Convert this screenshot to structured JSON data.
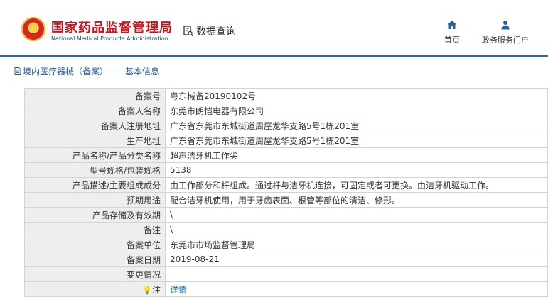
{
  "header": {
    "logo_cn": "国家药品监督管理局",
    "logo_en": "National Medical Products Administration",
    "query_label": "数据查询",
    "nav": [
      {
        "label": "首页",
        "icon": "home-icon"
      },
      {
        "label": "政务服务门户",
        "icon": "user-icon"
      }
    ]
  },
  "panel": {
    "title": "境内医疗器械（备案）——基本信息"
  },
  "rows": [
    {
      "label": "备案号",
      "value": "粤东械备20190102号"
    },
    {
      "label": "备案人名称",
      "value": "东莞市朗恺电器有限公司"
    },
    {
      "label": "备案人注册地址",
      "value": "广东省东莞市东城街道周屋龙华支路5号1栋201室"
    },
    {
      "label": "生产地址",
      "value": "广东省东莞市东城街道周屋龙华支路5号1栋201室"
    },
    {
      "label": "产品名称/产品分类名称",
      "value": "超声洁牙机工作尖"
    },
    {
      "label": "型号规格/包装规格",
      "value": "5138"
    },
    {
      "label": "产品描述/主要组成成分",
      "value": "由工作部分和杆组成。通过杆与洁牙机连接，可固定或者可更换。由洁牙机驱动工作。"
    },
    {
      "label": "预期用途",
      "value": "配合洁牙机使用，用于牙齿表面、根管等部位的清洁、修形。"
    },
    {
      "label": "产品存储及有效期",
      "value": "\\"
    },
    {
      "label": "备注",
      "value": "\\"
    },
    {
      "label": "备案单位",
      "value": "东莞市市场监督管理局"
    },
    {
      "label": "备案日期",
      "value": "2019-08-21"
    },
    {
      "label": "变更情况",
      "value": ""
    }
  ],
  "note_row": {
    "label": "注",
    "link": "详情",
    "icon": "bulb-icon"
  },
  "colors": {
    "accent": "#1f6fb8",
    "logo_red": "#c8161d",
    "label_bg": "#eeeeee"
  }
}
